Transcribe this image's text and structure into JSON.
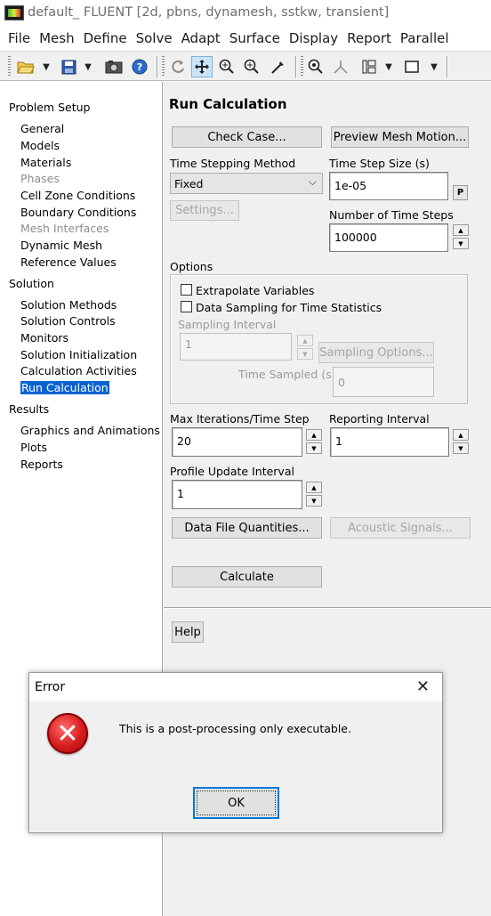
{
  "window": {
    "title": "default_ FLUENT  [2d, pbns, dynamesh, sstkw, transient]"
  },
  "menubar": [
    "File",
    "Mesh",
    "Define",
    "Solve",
    "Adapt",
    "Surface",
    "Display",
    "Report",
    "Parallel"
  ],
  "toolbar": {
    "icons": [
      "open-file-icon",
      "save-icon",
      "camera-icon",
      "help-icon",
      "rotate-icon",
      "pan-icon",
      "zoom-in-icon",
      "zoom-box-icon",
      "probe-icon",
      "zoom-fit-icon",
      "axes-icon",
      "layout-icon",
      "window-icon"
    ]
  },
  "tree": {
    "problem_setup": "Problem Setup",
    "problem_setup_items": [
      "General",
      "Models",
      "Materials",
      "Phases",
      "Cell Zone Conditions",
      "Boundary Conditions",
      "Mesh Interfaces",
      "Dynamic Mesh",
      "Reference Values"
    ],
    "solution": "Solution",
    "solution_items": [
      "Solution Methods",
      "Solution Controls",
      "Monitors",
      "Solution Initialization",
      "Calculation Activities",
      "Run Calculation"
    ],
    "results": "Results",
    "results_items": [
      "Graphics and Animations",
      "Plots",
      "Reports"
    ]
  },
  "panel": {
    "title": "Run Calculation",
    "check_case": "Check Case...",
    "preview_mesh_motion": "Preview Mesh Motion...",
    "time_stepping_method_label": "Time Stepping Method",
    "time_stepping_method_value": "Fixed",
    "time_step_size_label": "Time Step Size (s)",
    "time_step_size_value": "1e-05",
    "p_button": "P",
    "settings": "Settings...",
    "num_time_steps_label": "Number of Time Steps",
    "num_time_steps_value": "100000",
    "options_label": "Options",
    "extrapolate_variables": "Extrapolate Variables",
    "data_sampling": "Data Sampling for Time Statistics",
    "sampling_interval_label": "Sampling Interval",
    "sampling_interval_value": "1",
    "sampling_options": "Sampling Options...",
    "time_sampled_label": "Time Sampled (s)",
    "time_sampled_value": "0",
    "max_iterations_label": "Max Iterations/Time Step",
    "max_iterations_value": "20",
    "reporting_interval_label": "Reporting Interval",
    "reporting_interval_value": "1",
    "profile_update_label": "Profile Update Interval",
    "profile_update_value": "1",
    "data_file_quantities": "Data File Quantities...",
    "acoustic_signals": "Acoustic Signals...",
    "calculate": "Calculate",
    "help": "Help"
  },
  "dialog": {
    "title": "Error",
    "close_glyph": "✕",
    "message": "This is a post-processing only executable.",
    "ok": "OK",
    "error_glyph": "✕"
  }
}
